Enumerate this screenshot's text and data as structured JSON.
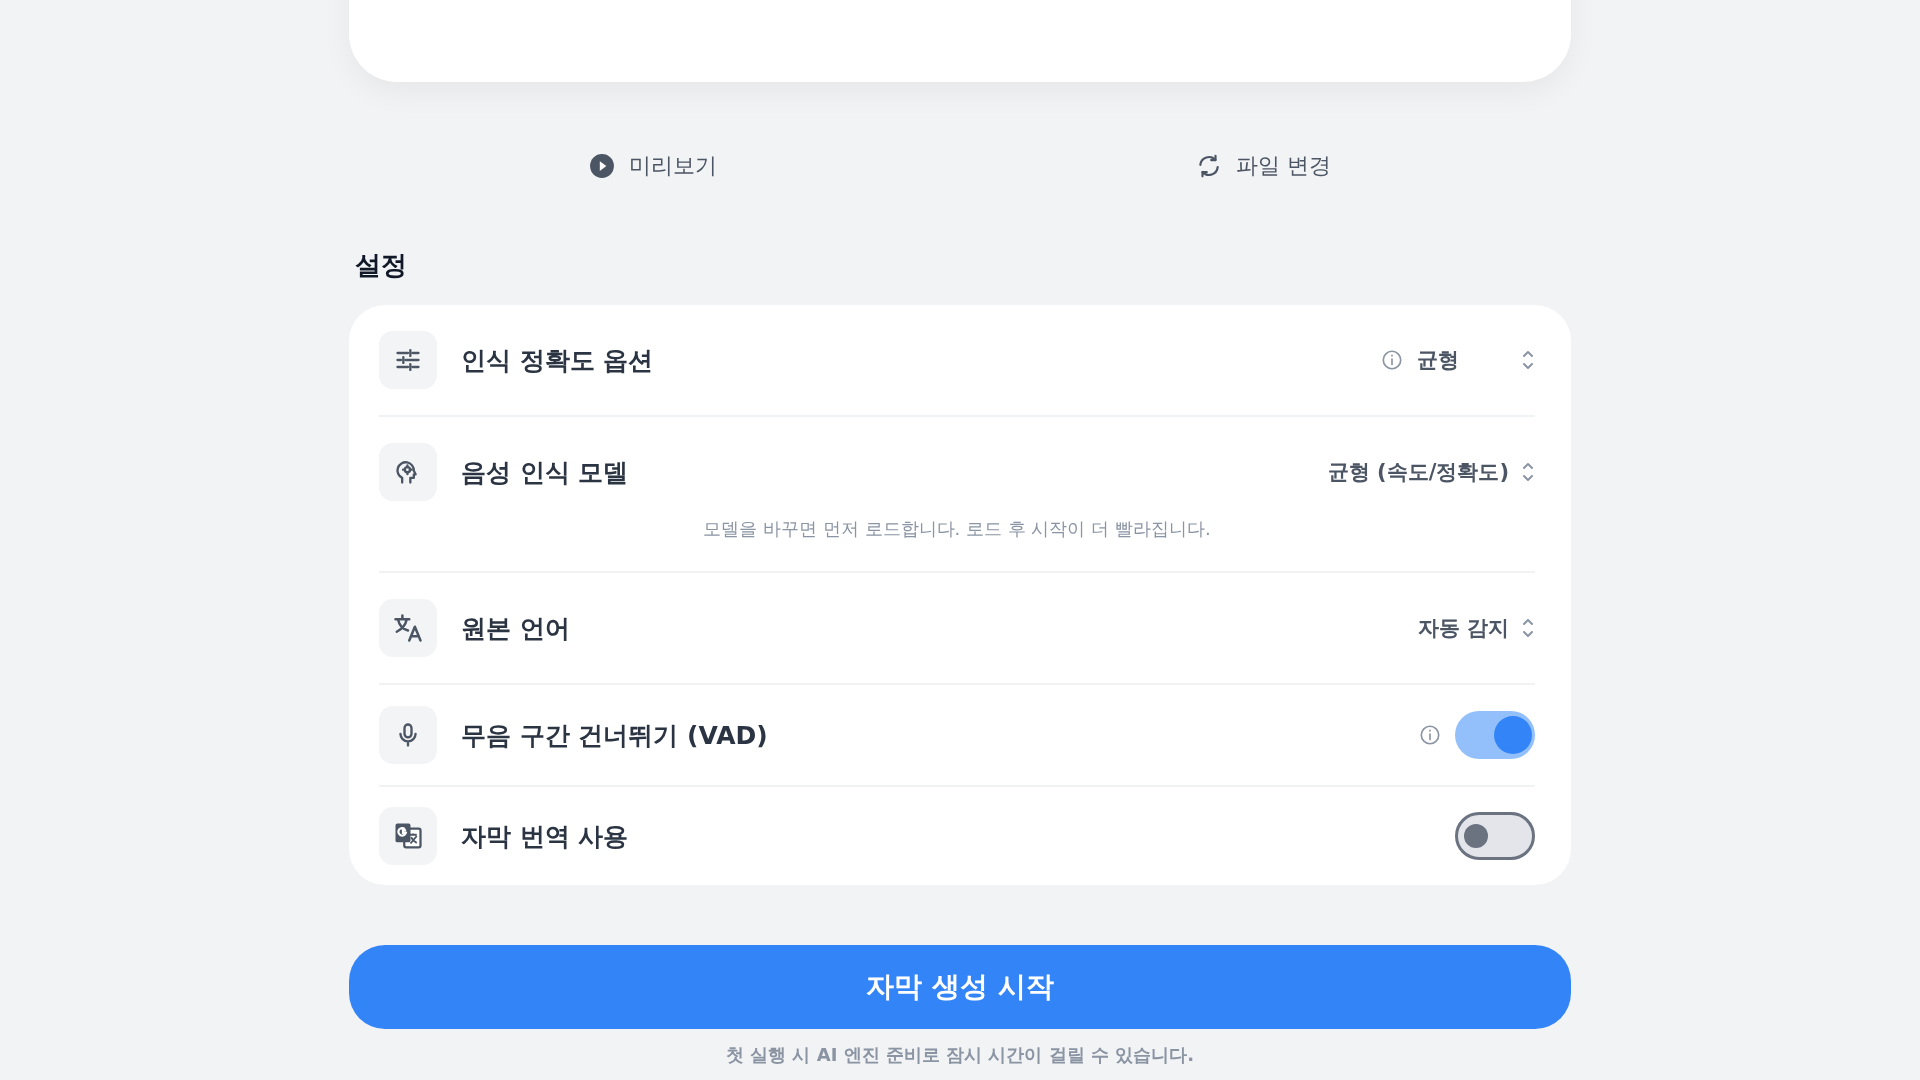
{
  "actions": [
    {
      "kind": "play",
      "label": "미리보기"
    },
    {
      "kind": "refresh",
      "label": "파일 변경"
    }
  ],
  "settings": {
    "title": "설정",
    "rows": [
      {
        "kind": "select",
        "label": "인식 정확도 옵션",
        "info": true,
        "value": "균형"
      },
      {
        "kind": "select",
        "label": "음성 인식 모델",
        "info": false,
        "value": "균형 (속도/정확도)",
        "hint": "모델을 바꾸면 먼저 로드합니다. 로드 후 시작이 더 빨라집니다."
      },
      {
        "kind": "select",
        "label": "원본 언어",
        "info": false,
        "value": "자동 감지"
      },
      {
        "kind": "toggle",
        "label": "무음 구간 건너뛰기 (VAD)",
        "info": true,
        "on": true
      },
      {
        "kind": "toggle",
        "label": "자막 번역 사용",
        "info": false,
        "on": false
      }
    ]
  },
  "start_button": "자막 생성 시작",
  "footnote": "첫 실행 시 AI 엔진 준비로 잠시 시간이 걸릴 수 있습니다."
}
